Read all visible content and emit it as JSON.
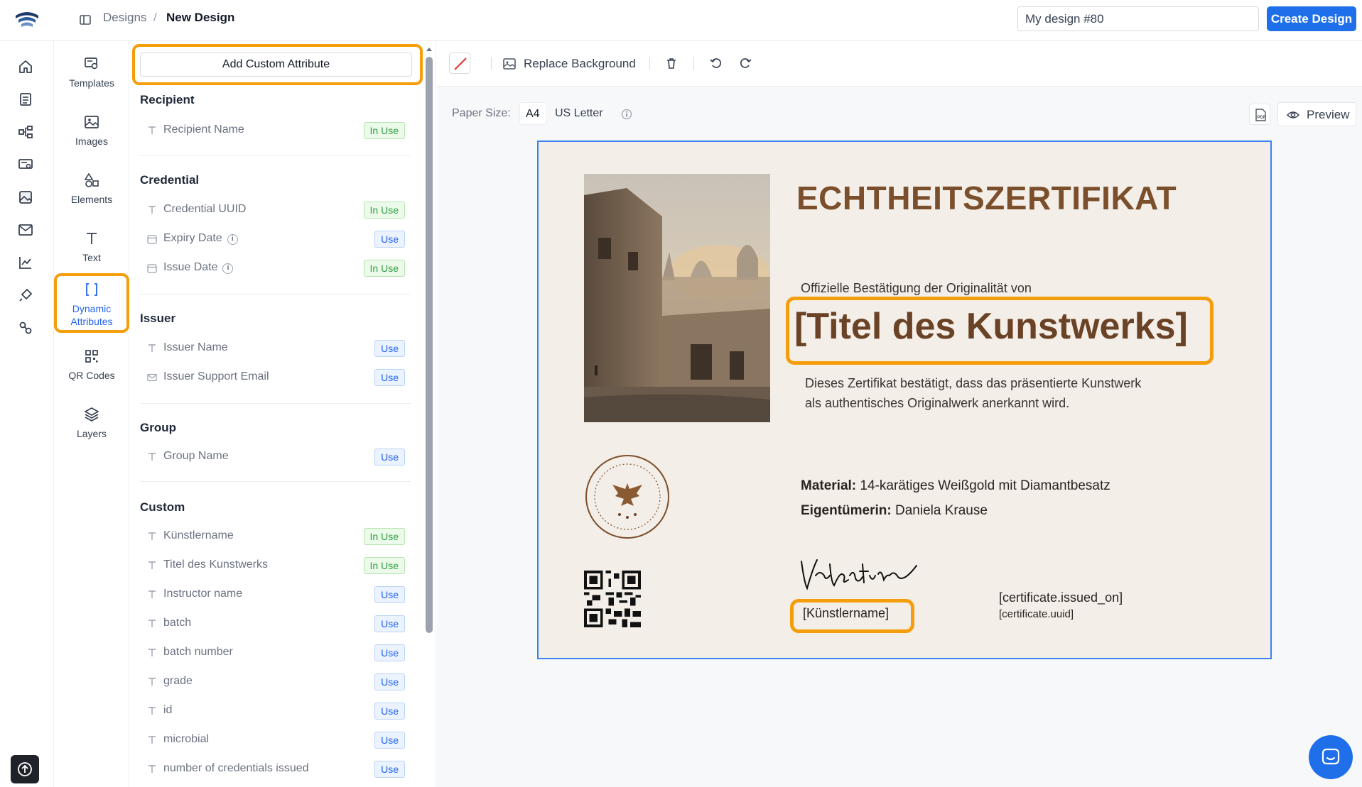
{
  "topbar": {
    "breadcrumb_parent": "Designs",
    "breadcrumb_separator": "/",
    "breadcrumb_current": "New Design",
    "design_name_value": "My design #80",
    "create_button": "Create Design"
  },
  "tools": [
    {
      "label": "Templates"
    },
    {
      "label": "Images"
    },
    {
      "label": "Elements"
    },
    {
      "label": "Text"
    },
    {
      "label": "Dynamic",
      "label2": "Attributes",
      "active": true
    },
    {
      "label": "QR Codes"
    },
    {
      "label": "Layers"
    }
  ],
  "panel": {
    "add_custom_attribute": "Add Custom Attribute",
    "sections": [
      {
        "title": "Recipient",
        "items": [
          {
            "name": "Recipient Name",
            "status": "In Use",
            "icon": "text-type-icon"
          }
        ]
      },
      {
        "title": "Credential",
        "items": [
          {
            "name": "Credential UUID",
            "status": "In Use",
            "icon": "text-type-icon"
          },
          {
            "name": "Expiry Date",
            "status": "Use",
            "icon": "calendar-icon",
            "info": true
          },
          {
            "name": "Issue Date",
            "status": "In Use",
            "icon": "calendar-icon",
            "info": true
          }
        ]
      },
      {
        "title": "Issuer",
        "items": [
          {
            "name": "Issuer Name",
            "status": "Use",
            "icon": "text-type-icon"
          },
          {
            "name": "Issuer Support Email",
            "status": "Use",
            "icon": "mail-icon"
          }
        ]
      },
      {
        "title": "Group",
        "items": [
          {
            "name": "Group Name",
            "status": "Use",
            "icon": "text-type-icon"
          }
        ]
      },
      {
        "title": "Custom",
        "items": [
          {
            "name": "Künstlername",
            "status": "In Use",
            "icon": "text-type-icon"
          },
          {
            "name": "Titel des Kunstwerks",
            "status": "In Use",
            "icon": "text-type-icon"
          },
          {
            "name": "Instructor name",
            "status": "Use",
            "icon": "text-type-icon"
          },
          {
            "name": "batch",
            "status": "Use",
            "icon": "text-type-icon"
          },
          {
            "name": "batch number",
            "status": "Use",
            "icon": "text-type-icon"
          },
          {
            "name": "grade",
            "status": "Use",
            "icon": "text-type-icon"
          },
          {
            "name": "id",
            "status": "Use",
            "icon": "text-type-icon"
          },
          {
            "name": "microbial",
            "status": "Use",
            "icon": "text-type-icon"
          },
          {
            "name": "number of credentials issued",
            "status": "Use",
            "icon": "text-type-icon"
          }
        ]
      }
    ]
  },
  "toolbar": {
    "replace_background": "Replace Background"
  },
  "paper": {
    "label": "Paper Size:",
    "options": [
      "A4",
      "US Letter"
    ],
    "selected": "A4",
    "preview": "Preview"
  },
  "certificate": {
    "title": "ECHTHEITSZERTIFIKAT",
    "subtitle": "Offizielle Bestätigung der Originalität von",
    "artwork_placeholder": "[Titel des Kunstwerks]",
    "body_line1": "Dieses Zertifikat bestätigt, dass das präsentierte Kunstwerk",
    "body_line2": "als authentisches Originalwerk anerkannt wird.",
    "material_label": "Material:",
    "material_value": "14-karätiges Weißgold mit Diamantbesatz",
    "owner_label": "Eigentümerin:",
    "owner_value": "Daniela Krause",
    "artist_placeholder": "[Künstlername]",
    "issued_on_placeholder": "[certificate.issued_on]",
    "uuid_placeholder": "[certificate.uuid]"
  },
  "colors": {
    "accent": "#1f6feb",
    "highlight": "#f59e0b",
    "in_use": "#2f9e44",
    "use": "#2563eb",
    "cert_bg": "#f3eee7",
    "cert_title": "#7b4f2c"
  }
}
